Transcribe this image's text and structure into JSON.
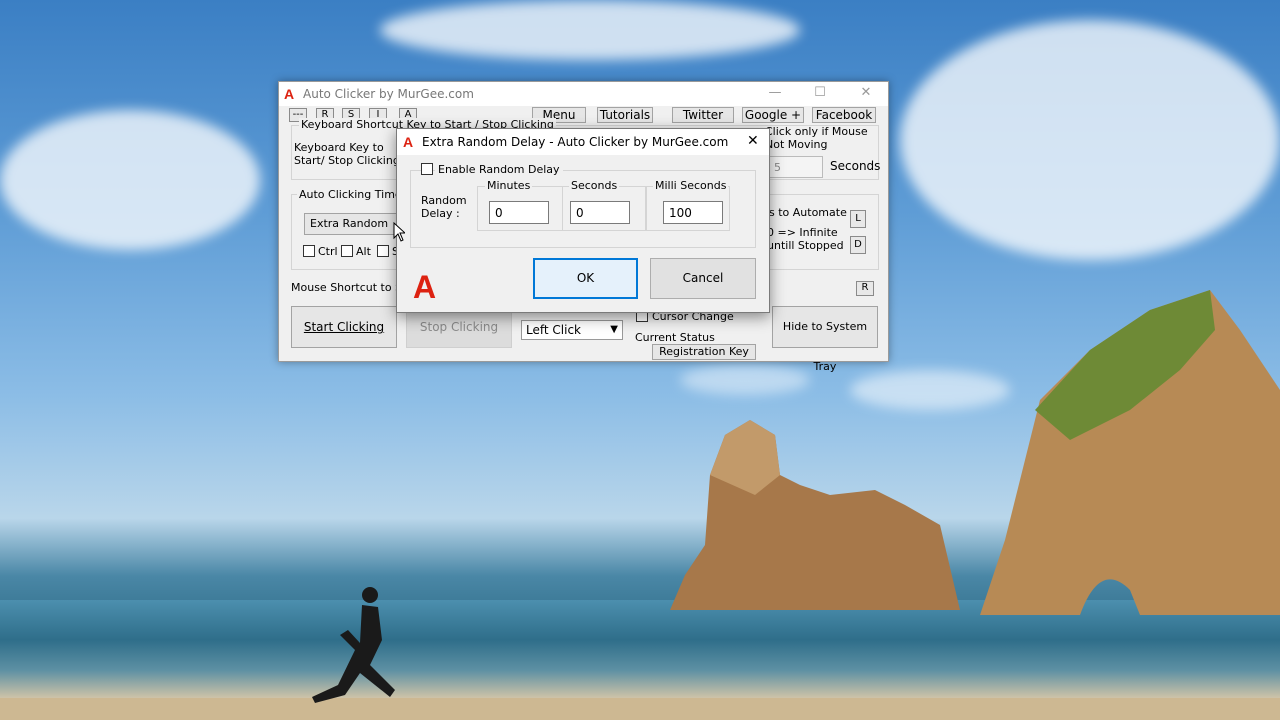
{
  "main_window": {
    "title": "Auto Clicker by MurGee.com",
    "title_logo": "A",
    "minimize_glyph": "—",
    "maximize_glyph": "☐",
    "close_glyph": "✕",
    "tiny_buttons": [
      "---",
      "R",
      "S",
      "I",
      "A"
    ],
    "header_buttons": [
      "Menu",
      "Tutorials",
      "Twitter",
      "Google +",
      "Facebook"
    ],
    "shortcut_group_label": "Keyboard Shortcut Key to Start / Stop Clicking",
    "keyboard_key_label": "Keyboard Key to\nStart/ Stop Clicking :",
    "click_if_not_moving_label": "Click only if Mouse\nNot Moving",
    "seconds_value": "5",
    "seconds_label": "Seconds",
    "auto_clicking_time_label": "Auto Clicking Time D",
    "extra_random_delay_button": "Extra Random Del",
    "modifiers": [
      "Ctrl",
      "Alt",
      "S"
    ],
    "clicks_to_automate_label": "s to Automate",
    "infinite_label": "0 => Infinite\nuntill Stopped",
    "l_button": "L",
    "d_button": "D",
    "mouse_shortcut_label": "Mouse Shortcut to Sta",
    "r_button": "R",
    "start_button": "Start Clicking",
    "stop_button": "Stop Clicking",
    "click_type": "Left Click",
    "cursor_change_label": "Cursor Change",
    "current_status_label": "Current Status",
    "registration_button": "Registration Key",
    "hide_tray_button": "Hide to System Tray"
  },
  "dialog": {
    "title": "Extra Random Delay - Auto Clicker by MurGee.com",
    "title_logo": "A",
    "close_glyph": "✕",
    "enable_label": "Enable Random Delay",
    "random_delay_label": "Random\nDelay :",
    "minutes_label": "Minutes",
    "minutes_value": "0",
    "seconds_label": "Seconds",
    "seconds_value": "0",
    "milli_label": "Milli Seconds",
    "milli_value": "100",
    "logo": "A",
    "ok_label": "OK",
    "cancel_label": "Cancel"
  },
  "colors": {
    "logo_red": "#dd1111",
    "focus_blue": "#0078d7"
  }
}
